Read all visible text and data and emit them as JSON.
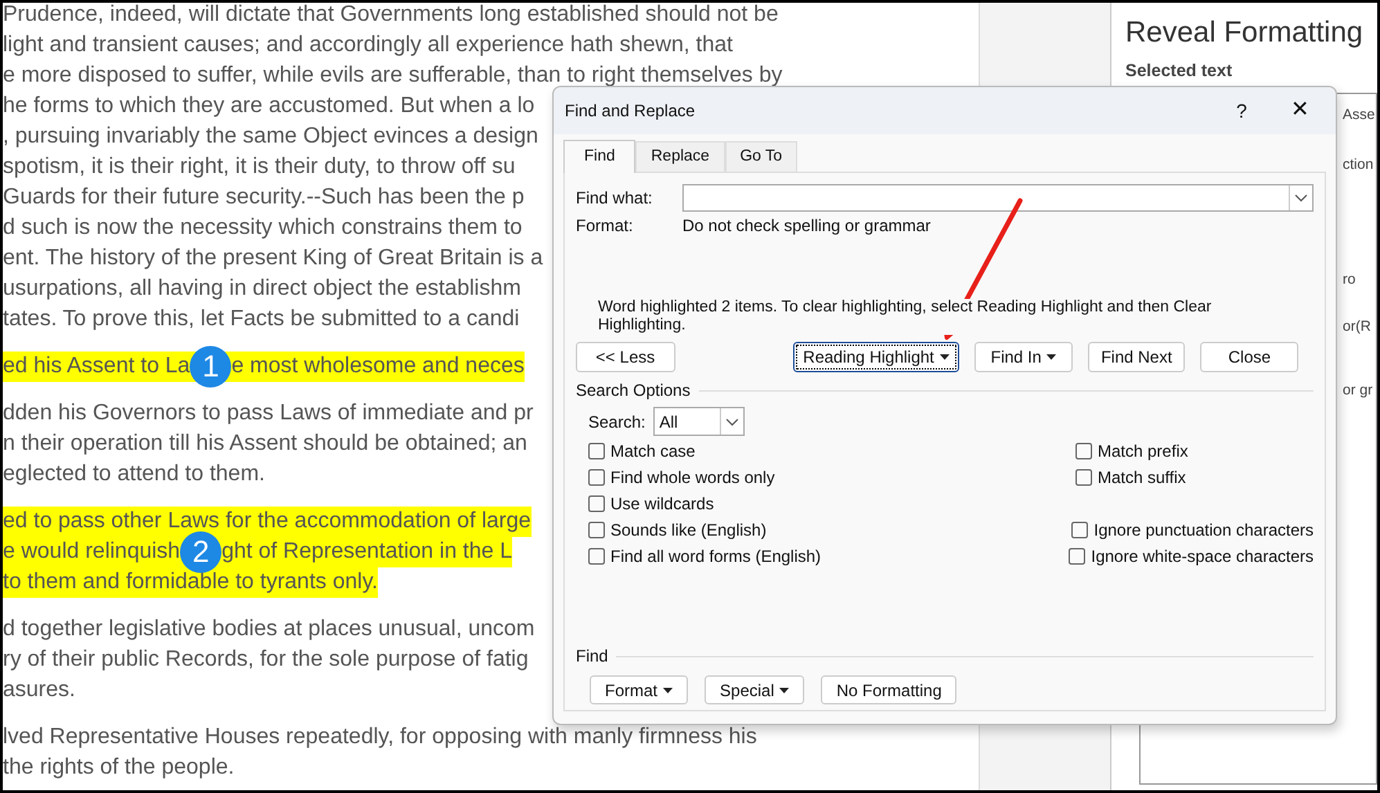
{
  "document": {
    "paragraphs": [
      {
        "highlighted": false,
        "lines": [
          {
            "parts": [
              "Prudence, indeed, will dictate that Governments long established should not be"
            ]
          },
          {
            "parts": [
              "light and transient causes; and accordingly all experience hath shewn, that"
            ]
          },
          {
            "parts": [
              "e more disposed to suffer, while evils are sufferable, than to right themselves by"
            ]
          },
          {
            "parts": [
              "he forms to which they are accustomed. But when a lo"
            ]
          },
          {
            "parts": [
              ", pursuing invariably the same Object evinces a design"
            ]
          },
          {
            "parts": [
              "spotism, it is their right, it is their duty, to throw off su"
            ]
          },
          {
            "parts": [
              "Guards for their future security.--Such has been the p"
            ]
          },
          {
            "parts": [
              "d such is now the necessity which constrains them to"
            ]
          },
          {
            "parts": [
              "ent. The history of the present King of Great Britain is a"
            ]
          },
          {
            "parts": [
              "usurpations, all having in direct object the establishm"
            ]
          },
          {
            "parts": [
              "tates. To prove this, let Facts be submitted to a candi"
            ]
          }
        ]
      },
      {
        "highlighted": true,
        "lines": [
          {
            "parts": [
              "ed his Assent to La",
              "e most wholesome and neces"
            ],
            "badge": "1"
          }
        ]
      },
      {
        "highlighted": false,
        "lines": [
          {
            "parts": [
              "dden his Governors to pass Laws of immediate and pr"
            ]
          },
          {
            "parts": [
              "n their operation till his Assent should be obtained; an"
            ]
          },
          {
            "parts": [
              "eglected to attend to them."
            ]
          }
        ]
      },
      {
        "highlighted": true,
        "lines": [
          {
            "parts": [
              "ed to pass other Laws for the accommodation of large"
            ]
          },
          {
            "parts": [
              "e would relinquish",
              "ght of Representation in the L"
            ],
            "badge": "2"
          },
          {
            "parts": [
              "to them and formidable to tyrants only."
            ]
          }
        ]
      },
      {
        "highlighted": false,
        "lines": [
          {
            "parts": [
              "d together legislative bodies at places unusual, uncom"
            ]
          },
          {
            "parts": [
              "ry of their public Records, for the sole purpose of fatig"
            ]
          },
          {
            "parts": [
              "asures."
            ]
          }
        ]
      },
      {
        "highlighted": false,
        "lines": [
          {
            "parts": [
              "lved Representative Houses repeatedly, for opposing with manly firmness his"
            ]
          },
          {
            "parts": [
              "the rights of the people."
            ]
          }
        ]
      }
    ]
  },
  "reveal_pane": {
    "title": "Reveal Formatting",
    "subtitle": "Selected text",
    "fragments": [
      "Asse",
      "ction",
      "ro",
      "or(R",
      "or gr"
    ]
  },
  "dialog": {
    "title": "Find and Replace",
    "help": "?",
    "close": "✕",
    "tabs": [
      {
        "label": "Find",
        "selected": true
      },
      {
        "label": "Replace",
        "selected": false
      },
      {
        "label": "Go To",
        "selected": false
      }
    ],
    "find_what": {
      "label": "Find what:"
    },
    "format": {
      "label": "Format:",
      "value": "Do not check spelling or grammar"
    },
    "message": "Word highlighted 2 items. To clear highlighting, select Reading Highlight and then Clear Highlighting.",
    "less_button": "<< Less",
    "action_buttons": [
      {
        "label": "Reading Highlight",
        "dropdown": true,
        "focused": true
      },
      {
        "label": "Find In",
        "dropdown": true,
        "focused": false
      },
      {
        "label": "Find Next",
        "dropdown": false,
        "focused": false
      },
      {
        "label": "Close",
        "dropdown": false,
        "focused": false
      }
    ],
    "search_options": {
      "title": "Search Options",
      "search_label": "Search:",
      "search_value": "All",
      "rows": [
        {
          "left": {
            "label": "Match case",
            "checked": false
          },
          "right": {
            "label": "Match prefix",
            "checked": false
          }
        },
        {
          "left": {
            "label": "Find whole words only",
            "checked": false
          },
          "right": {
            "label": "Match suffix",
            "checked": false
          }
        },
        {
          "left": {
            "label": "Use wildcards",
            "checked": false
          }
        },
        {
          "left": {
            "label": "Sounds like (English)",
            "checked": false
          },
          "right": {
            "label": "Ignore punctuation characters",
            "checked": false
          }
        },
        {
          "left": {
            "label": "Find all word forms (English)",
            "checked": false
          },
          "right": {
            "label": "Ignore white-space characters",
            "checked": false
          }
        }
      ]
    },
    "find_section": {
      "title": "Find",
      "buttons": [
        {
          "label": "Format",
          "dropdown": true
        },
        {
          "label": "Special",
          "dropdown": true
        },
        {
          "label": "No Formatting",
          "dropdown": false
        }
      ]
    }
  }
}
